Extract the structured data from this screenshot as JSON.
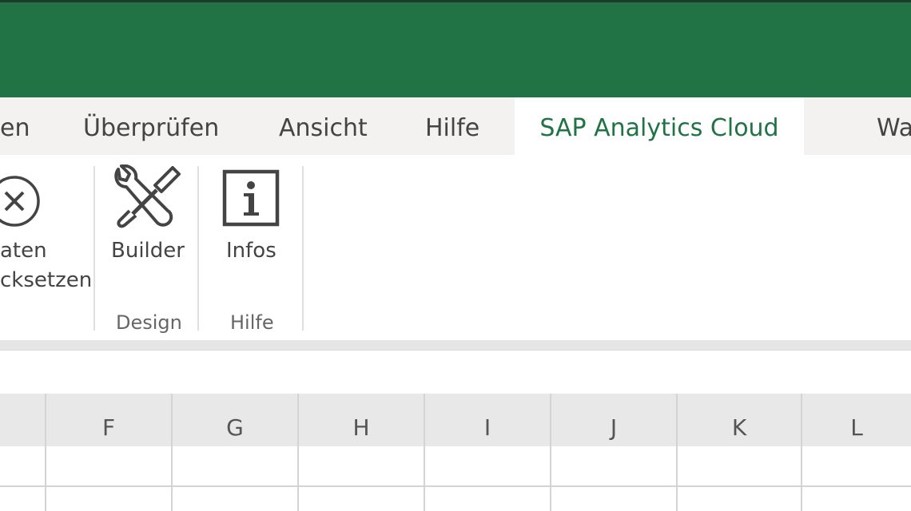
{
  "tabs": [
    {
      "label": "en"
    },
    {
      "label": "Überprüfen"
    },
    {
      "label": "Ansicht"
    },
    {
      "label": "Hilfe"
    },
    {
      "label": "SAP Analytics Cloud",
      "active": true
    },
    {
      "label": "Wa"
    }
  ],
  "ribbon": {
    "reset_line1": "aten",
    "reset_line2": "cksetzen",
    "builder_label": "Builder",
    "infos_label": "Infos",
    "groups": {
      "design": "Design",
      "hilfe": "Hilfe"
    }
  },
  "columns": [
    "F",
    "G",
    "H",
    "I",
    "J",
    "K",
    "L"
  ],
  "colors": {
    "titlebar": "#217346",
    "active_tab_text": "#217346"
  },
  "icons": {
    "reset": "close-circle-icon",
    "builder": "wrench-screwdriver-icon",
    "infos": "info-icon"
  }
}
